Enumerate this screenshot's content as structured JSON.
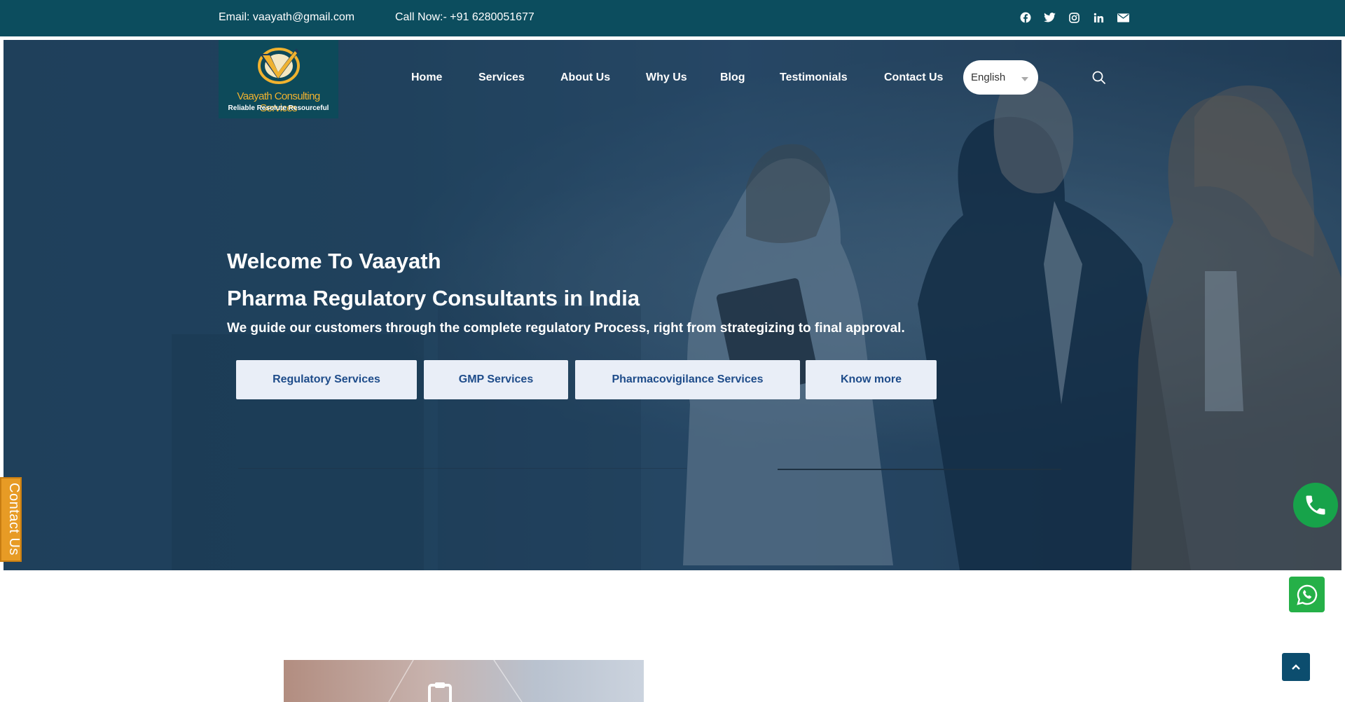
{
  "topbar": {
    "email": "Email: vaayath@gmail.com",
    "call": "Call Now:- +91 6280051677",
    "socials": [
      "facebook-icon",
      "twitter-icon",
      "instagram-icon",
      "linkedin-icon",
      "mail-icon"
    ]
  },
  "logo": {
    "brand": "Vaayath Consulting Services",
    "tagline": "Reliable Resolute Resourceful"
  },
  "nav": {
    "items": [
      "Home",
      "Services",
      "About Us",
      "Why Us",
      "Blog",
      "Testimonials",
      "Contact Us"
    ]
  },
  "language": {
    "selected": "English"
  },
  "hero": {
    "welcome": "Welcome To Vaayath",
    "headline": "Pharma Regulatory Consultants in India",
    "subline": "We guide our customers through the complete regulatory Process, right from strategizing to final approval.",
    "buttons": [
      "Regulatory Services",
      "GMP Services",
      "Pharmacovigilance Services",
      "Know more"
    ]
  },
  "widgets": {
    "contact_tab": "Contact Us"
  },
  "colors": {
    "topbar": "#0c4d5e",
    "accent_orange": "#e79b25",
    "button_text": "#1e4c8a",
    "whatsapp_green": "#25b048"
  }
}
